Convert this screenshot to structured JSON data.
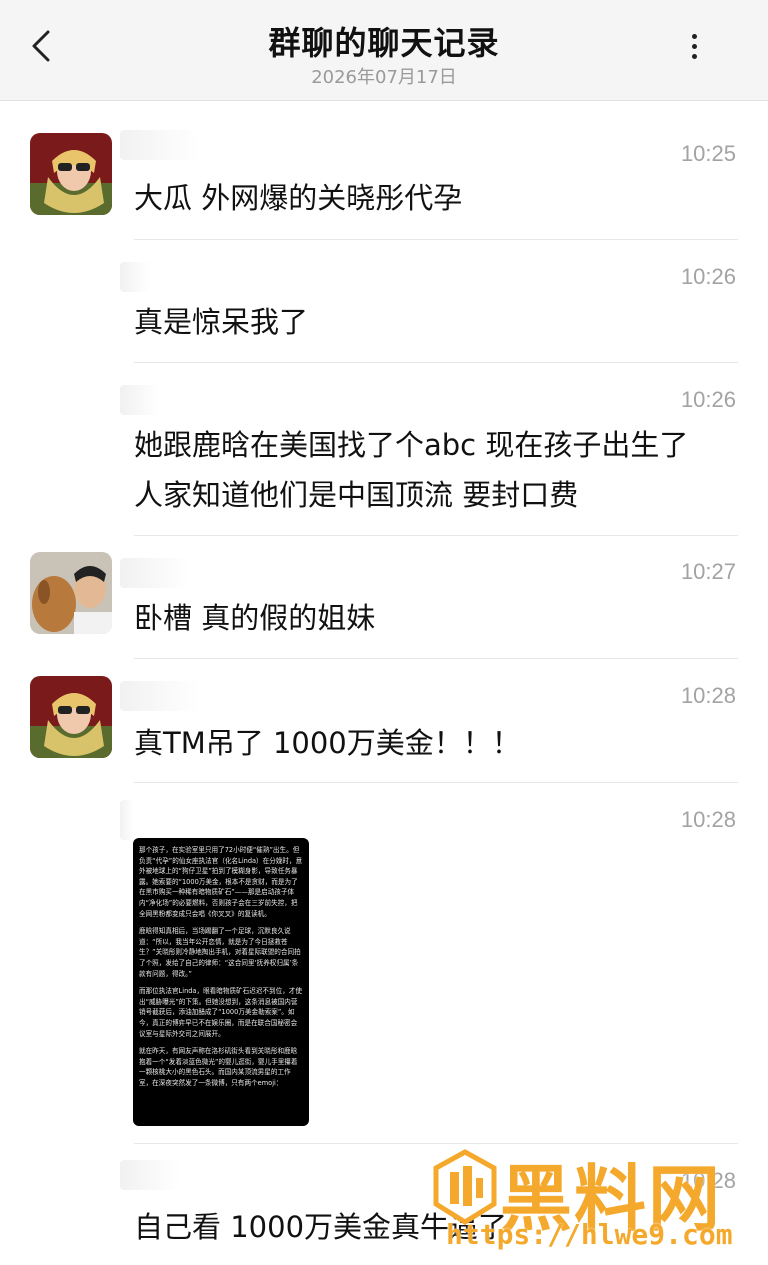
{
  "header": {
    "title": "群聊的聊天记录",
    "subtitle": "2026年07月17日"
  },
  "messages": [
    {
      "time": "10:25",
      "text": "大瓜 外网爆的关晓彤代孕"
    },
    {
      "time": "10:26",
      "text": "真是惊呆我了"
    },
    {
      "time": "10:26",
      "text": "她跟鹿晗在美国找了个abc 现在孩子出生了\n人家知道他们是中国顶流 要封口费"
    },
    {
      "time": "10:27",
      "text": "卧槽 真的假的姐妹"
    },
    {
      "time": "10:28",
      "text": "真TM吊了 1000万美金！！！"
    },
    {
      "time": "10:28",
      "image_paragraphs": [
        "那个孩子，在实验室里只用了72小时便“催熟”出生。但负责“代孕”的仙女座执法官（化名Linda）在分娩时，意外被地球上的“狗仔卫星”拍到了模糊身影，导致任务暴露。她索要的“1000万美金，根本不是贪财，而是为了在黑市购买一种稀有暗物质矿石”——那是启动孩子体内“净化场”的必要燃料，否则孩子会在三岁前失控，把全网黑粉都变成只会唱《你叉叉》的复读机。",
        "鹿晗得知真相后，当场踢翻了一个足球，沉默良久说道：“所以，我当年公开恋情，就是为了今日拯救苍生？”关晓彤则冷静地掏出手机，对着星际联盟的合同拍了个照，发给了自己的律师：“这合同里‘抚养权归属’条款有问题，得改。”",
        "而那位执法官Linda，眼看暗物质矿石迟迟不到位，才使出“威胁曝光”的下策。但她没想到，这条消息被国内营销号截获后，添油加醋成了“1000万美金勒索案”。如今，真正的博弈早已不在娱乐圈，而是在联合国秘密会议室与星际外交司之间展开。",
        "就在昨天，有网友声称在洛杉矶街头看到关晓彤和鹿晗抱着一个“发着淡蓝色微光”的婴儿逛街，婴儿手里攥着一颗核桃大小的黑色石头。而国内某顶流男星的工作室，在深夜突然发了一条微博，只有两个emoji："
      ]
    },
    {
      "time": "10:28",
      "text": "自己看 1000万美金真牛逼了"
    }
  ],
  "watermark": {
    "brand": "黑料网",
    "url": "https://hlwe9.com"
  },
  "icons": [
    "back-arrow-icon",
    "more-dots-icon"
  ],
  "colors": {
    "watermark": "#f4a92c",
    "header_bg": "#f5f5f5",
    "time": "#a3a3a3"
  }
}
